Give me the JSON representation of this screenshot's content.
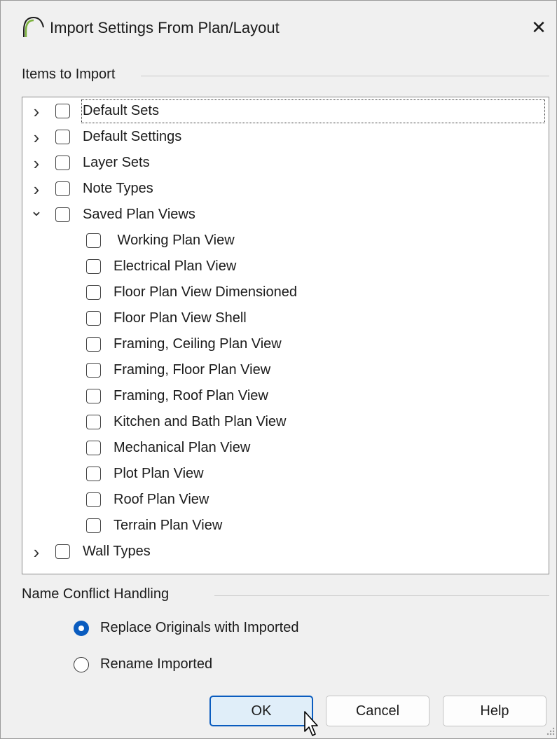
{
  "window": {
    "title": "Import Settings From Plan/Layout",
    "app_icon": "chief-architect-arc-icon",
    "close_icon": "close-icon",
    "close_glyph": "✕"
  },
  "items_group": {
    "label": "Items to Import",
    "rows": [
      {
        "label": "Default Sets",
        "level": 0,
        "expander": "collapsed",
        "expander_glyph": "›",
        "checked": false
      },
      {
        "label": "Default Settings",
        "level": 0,
        "expander": "collapsed",
        "expander_glyph": "›",
        "checked": false
      },
      {
        "label": "Layer Sets",
        "level": 0,
        "expander": "collapsed",
        "expander_glyph": "›",
        "checked": false
      },
      {
        "label": "Note Types",
        "level": 0,
        "expander": "collapsed",
        "expander_glyph": "›",
        "checked": false
      },
      {
        "label": "Saved Plan Views",
        "level": 0,
        "expander": "expanded",
        "expander_glyph": "⌄",
        "checked": false
      },
      {
        "label": " Working Plan View",
        "level": 1,
        "checked": false
      },
      {
        "label": "Electrical Plan View",
        "level": 1,
        "checked": false
      },
      {
        "label": "Floor Plan View Dimensioned",
        "level": 1,
        "checked": false
      },
      {
        "label": "Floor Plan View Shell",
        "level": 1,
        "checked": false
      },
      {
        "label": "Framing, Ceiling Plan View",
        "level": 1,
        "checked": false
      },
      {
        "label": "Framing, Floor Plan View",
        "level": 1,
        "checked": false
      },
      {
        "label": "Framing, Roof Plan View",
        "level": 1,
        "checked": false
      },
      {
        "label": "Kitchen and Bath Plan View",
        "level": 1,
        "checked": false
      },
      {
        "label": "Mechanical Plan View",
        "level": 1,
        "checked": false
      },
      {
        "label": "Plot Plan View",
        "level": 1,
        "checked": false
      },
      {
        "label": "Roof Plan View",
        "level": 1,
        "checked": false
      },
      {
        "label": "Terrain Plan View",
        "level": 1,
        "checked": false
      },
      {
        "label": "Wall Types",
        "level": 0,
        "expander": "collapsed",
        "expander_glyph": "›",
        "checked": false
      }
    ]
  },
  "conflict_group": {
    "label": "Name Conflict Handling",
    "options": [
      {
        "label": "Replace Originals with Imported",
        "selected": true
      },
      {
        "label": "Rename Imported",
        "selected": false
      }
    ]
  },
  "buttons": {
    "ok": "OK",
    "cancel": "Cancel",
    "help": "Help"
  },
  "colors": {
    "accent": "#0a5cbf",
    "dialog_bg": "#f0f0f0",
    "default_button_bg": "#e0eef9"
  }
}
